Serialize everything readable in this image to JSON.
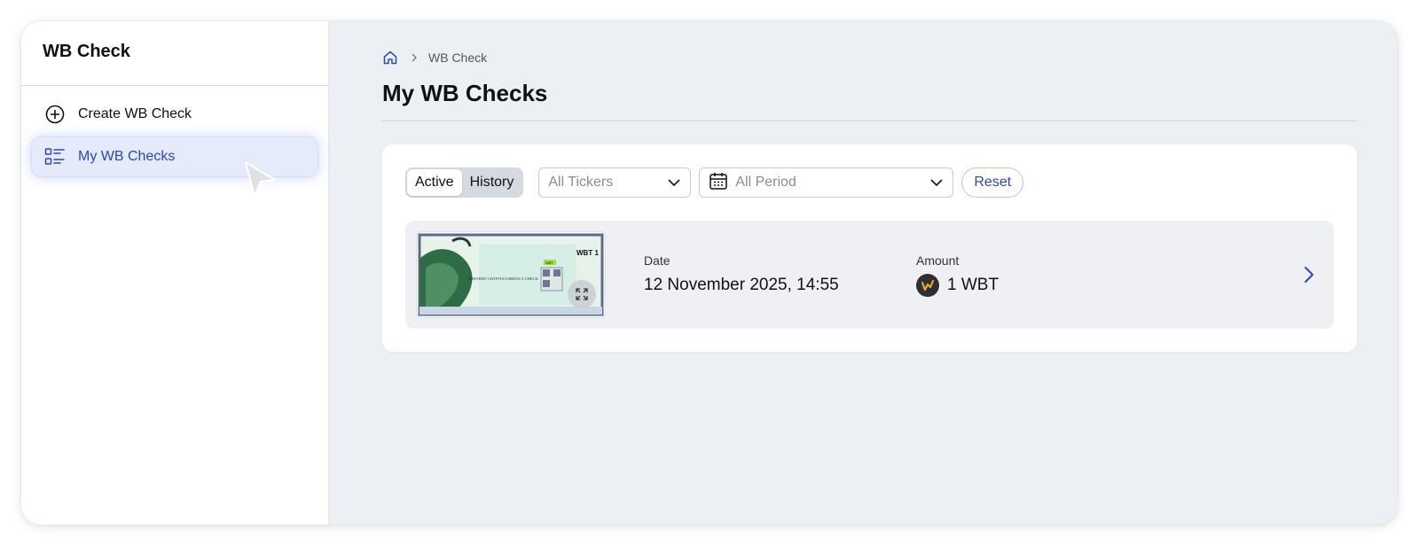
{
  "app": {
    "title": "WB Check"
  },
  "sidebar": {
    "items": [
      {
        "label": "Create WB Check",
        "icon": "plus-circle-icon",
        "active": false
      },
      {
        "label": "My WB Checks",
        "icon": "list-icon",
        "active": true
      }
    ]
  },
  "breadcrumb": {
    "home_icon": "home-icon",
    "current": "WB Check"
  },
  "page": {
    "title": "My WB Checks"
  },
  "filters": {
    "tabs": [
      {
        "label": "Active",
        "selected": true
      },
      {
        "label": "History",
        "selected": false
      }
    ],
    "tickers_placeholder": "All Tickers",
    "period_placeholder": "All Period",
    "reset_label": "Reset"
  },
  "checks": [
    {
      "date_label": "Date",
      "date_value": "12 November 2025, 14:55",
      "amount_label": "Amount",
      "amount_value": "1 WBT",
      "thumbnail_text": {
        "title": "WHITEBIT CRYPTOCURRENCY CHECK",
        "amount": "WBT 1",
        "badge": "WBT"
      }
    }
  ],
  "colors": {
    "accent": "#2847c7",
    "background": "#eceff4",
    "active_nav": "#e6ebfb",
    "coin": "#2d2f33",
    "coin_mark": "#f2a623"
  }
}
